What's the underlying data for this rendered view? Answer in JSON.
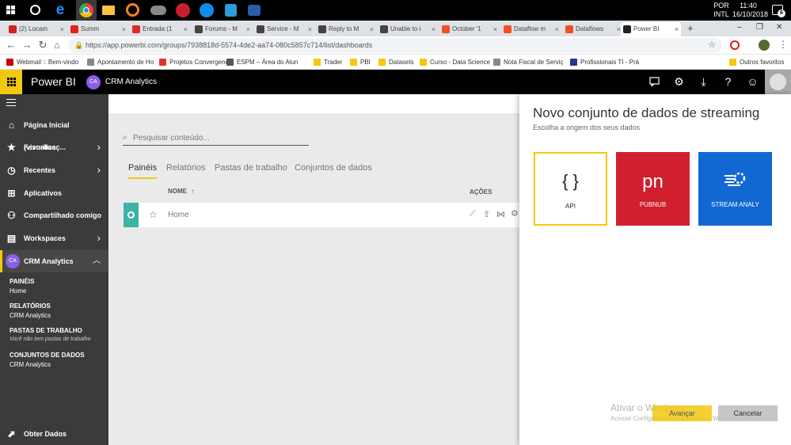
{
  "taskbar": {
    "lang": "POR",
    "layout": "INTL",
    "time": "11:40",
    "date": "16/10/2018",
    "badge": "6"
  },
  "tabs": [
    {
      "label": "(2) Locam",
      "color": "#d21f1f"
    },
    {
      "label": "Summ",
      "color": "#e62117"
    },
    {
      "label": "Entrada (1",
      "color": "#d93025"
    },
    {
      "label": "Forums - M",
      "color": "#444"
    },
    {
      "label": "Service - M",
      "color": "#444"
    },
    {
      "label": "Reply to M",
      "color": "#444"
    },
    {
      "label": "Unable to i",
      "color": "#444"
    },
    {
      "label": "October '1",
      "color": "#f25022"
    },
    {
      "label": "Dataflow m",
      "color": "#f25022"
    },
    {
      "label": "Dataflows",
      "color": "#f25022"
    },
    {
      "label": "Power BI",
      "color": "#222"
    }
  ],
  "address": {
    "url": "https://app.powerbi.com/groups/7938818d-5574-4de2-aa74-080c5857c714/list/dashboards"
  },
  "bookmarks": [
    {
      "label": "Webmail :: Bem-vindo",
      "color": "#c00"
    },
    {
      "label": "Apontamento de Ho",
      "color": "#888"
    },
    {
      "label": "Projetos Convergenc",
      "color": "#d33"
    },
    {
      "label": "ESPM – Área do Alun",
      "color": "#555"
    },
    {
      "label": "Trader",
      "color": "#f2c811"
    },
    {
      "label": "PBI",
      "color": "#f2c811"
    },
    {
      "label": "Datasets",
      "color": "#f2c811"
    },
    {
      "label": "Curso - Data Science",
      "color": "#f2c811"
    },
    {
      "label": "Nota Fiscal de Serviç",
      "color": "#888"
    },
    {
      "label": "Profissionais TI - Prá",
      "color": "#1f3c88"
    },
    {
      "label": "Outros favoritos",
      "color": "#f2c811"
    }
  ],
  "pbi": {
    "brand": "Power BI",
    "workspace_initials": "CA",
    "workspace_name": "CRM Analytics"
  },
  "nav": {
    "home": "Página Inicial (visualizaç...",
    "favorites": "Favoritos",
    "recents": "Recentes",
    "apps": "Aplicativos",
    "shared": "Compartilhado comigo",
    "workspaces": "Workspaces",
    "workspace": "CRM Analytics",
    "workspace_initials": "CA",
    "sections": [
      {
        "heading": "PAINÉIS",
        "value": "Home"
      },
      {
        "heading": "RELATÓRIOS",
        "value": "CRM Analytics"
      },
      {
        "heading": "PASTAS DE TRABALHO",
        "value": "Você não tem pastas de trabalho"
      },
      {
        "heading": "CONJUNTOS DE DADOS",
        "value": "CRM Analytics"
      }
    ],
    "get_data": "Obter Dados"
  },
  "main": {
    "search_placeholder": "Pesquisar conteúdo...",
    "tabs": [
      "Painéis",
      "Relatórios",
      "Pastas de trabalho",
      "Conjuntos de dados"
    ],
    "col_name": "NOME",
    "col_actions": "AÇÕES",
    "row_name": "Home"
  },
  "panel": {
    "title": "Novo conjunto de dados de streaming",
    "subtitle": "Escolha a origem dos seus dados",
    "sources": [
      {
        "label": "API",
        "glyph": "{ }"
      },
      {
        "label": "PUBNUB",
        "glyph": "pn"
      },
      {
        "label": "STREAM ANALY",
        "glyph": ""
      }
    ],
    "watermark_title": "Ativar o Windows",
    "watermark_text": "Acesse Configurações para ativar o Windows.",
    "next": "Avançar",
    "cancel": "Cancelar"
  },
  "colors": {
    "accent": "#f2c811",
    "pubnub": "#d0202e",
    "stream": "#1268d3",
    "workspace": "#8b5fe6",
    "teal": "#3cb4a5"
  }
}
